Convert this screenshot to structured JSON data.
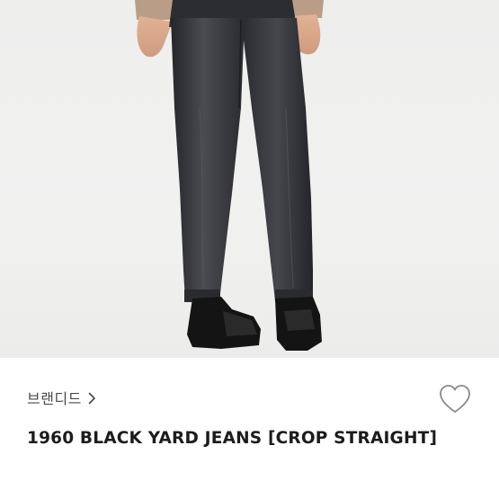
{
  "product": {
    "image_alt": "product-photo",
    "brand_label": "브랜디드",
    "brand_chevron_icon": "chevron-right-icon",
    "wishlist_icon": "heart-outline-icon",
    "title": "1960 BLACK YARD JEANS [CROP STRAIGHT]"
  },
  "colors": {
    "background": "#ffffff",
    "photo_bg": "#efefee",
    "denim": "#2f3034",
    "text_primary": "#1c1c1c",
    "text_secondary": "#4a4a4a"
  }
}
